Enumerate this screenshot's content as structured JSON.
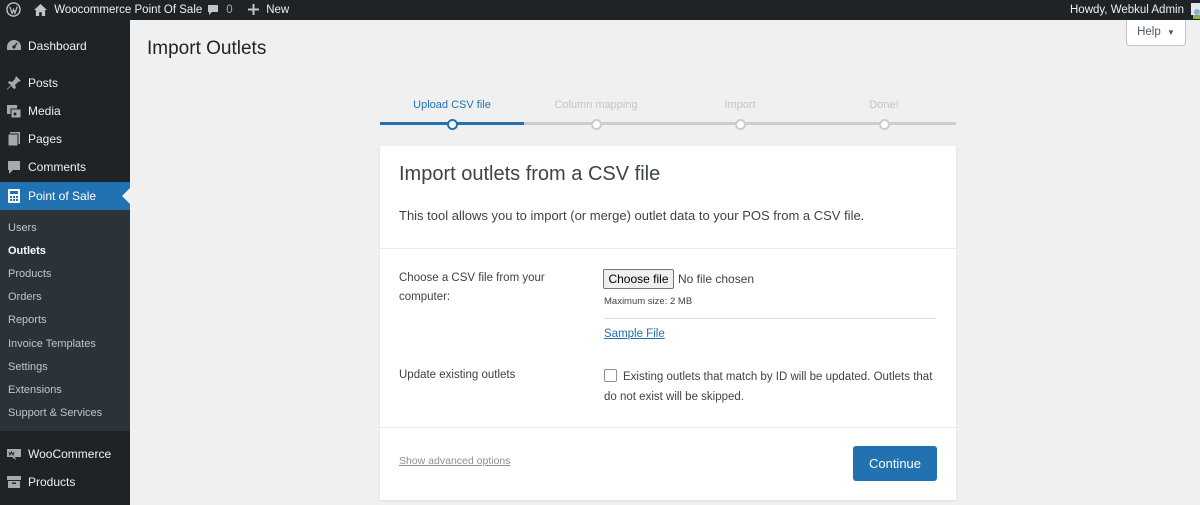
{
  "adminbar": {
    "site_name": "Woocommerce Point Of Sale",
    "comments_count": "0",
    "new_label": "New",
    "greeting": "Howdy, Webkul Admin"
  },
  "sidebar": {
    "items": [
      {
        "label": "Dashboard",
        "icon": "dashboard-icon"
      },
      {
        "label": "Posts",
        "icon": "pin-icon"
      },
      {
        "label": "Media",
        "icon": "media-icon"
      },
      {
        "label": "Pages",
        "icon": "pages-icon"
      },
      {
        "label": "Comments",
        "icon": "comment-icon"
      },
      {
        "label": "Point of Sale",
        "icon": "calculator-icon"
      },
      {
        "label": "WooCommerce",
        "icon": "woo-icon"
      },
      {
        "label": "Products",
        "icon": "archive-icon"
      }
    ],
    "submenu": [
      "Users",
      "Outlets",
      "Products",
      "Orders",
      "Reports",
      "Invoice Templates",
      "Settings",
      "Extensions",
      "Support & Services"
    ]
  },
  "help_label": "Help",
  "page_title": "Import Outlets",
  "steps": [
    "Upload CSV file",
    "Column mapping",
    "Import",
    "Done!"
  ],
  "card": {
    "title": "Import outlets from a CSV file",
    "description": "This tool allows you to import (or merge) outlet data to your POS from a CSV file.",
    "file_label": "Choose a CSV file from your computer:",
    "file_button": "Choose file",
    "file_status": "No file chosen",
    "max_size": "Maximum size: 2 MB",
    "sample_link": "Sample File",
    "update_label": "Update existing outlets",
    "update_desc": "Existing outlets that match by ID will be updated. Outlets that do not exist will be skipped.",
    "advanced_link": "Show advanced options",
    "continue_button": "Continue"
  },
  "colors": {
    "accent": "#2271b1",
    "sidebar_bg": "#1d2327",
    "submenu_bg": "#2c3338",
    "page_bg": "#f0f0f1"
  }
}
